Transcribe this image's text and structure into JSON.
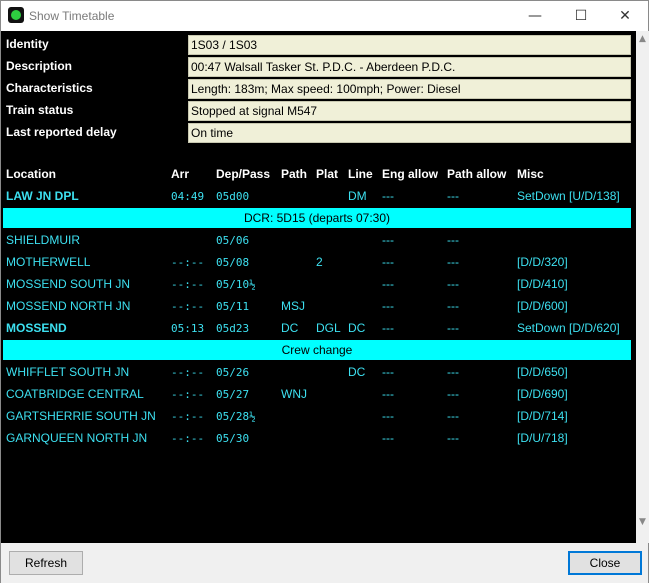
{
  "window": {
    "title": "Show Timetable",
    "min_symbol": "—",
    "max_symbol": "☐",
    "close_symbol": "✕"
  },
  "info": [
    {
      "label": "Identity",
      "value": "1S03 / 1S03"
    },
    {
      "label": "Description",
      "value": "00:47 Walsall Tasker St. P.D.C. - Aberdeen P.D.C."
    },
    {
      "label": "Characteristics",
      "value": "Length: 183m; Max speed: 100mph; Power: Diesel"
    },
    {
      "label": "Train status",
      "value": "Stopped at signal M547"
    },
    {
      "label": "Last reported delay",
      "value": "On time"
    }
  ],
  "columns": {
    "location": "Location",
    "arr": "Arr",
    "dep": "Dep/Pass",
    "path": "Path",
    "plat": "Plat",
    "line": "Line",
    "eng": "Eng allow",
    "pallow": "Path allow",
    "misc": "Misc"
  },
  "rows": [
    {
      "loc": "LAW JN DPL",
      "arr": "04:49",
      "dep": "05d00",
      "path": "",
      "plat": "",
      "line": "DM",
      "eng": "---",
      "pallow": "---",
      "misc": "SetDown [U/D/138]",
      "bold": true
    },
    {
      "banner": "DCR: 5D15 (departs 07:30)"
    },
    {
      "loc": "SHIELDMUIR",
      "arr": "",
      "dep": "05/06",
      "path": "",
      "plat": "",
      "line": "",
      "eng": "---",
      "pallow": "---",
      "misc": ""
    },
    {
      "loc": "MOTHERWELL",
      "arr": "--:--",
      "dep": "05/08",
      "path": "",
      "plat": "2",
      "line": "",
      "eng": "---",
      "pallow": "---",
      "misc": "[D/D/320]"
    },
    {
      "loc": "MOSSEND SOUTH JN",
      "arr": "--:--",
      "dep": "05/10½",
      "path": "",
      "plat": "",
      "line": "",
      "eng": "---",
      "pallow": "---",
      "misc": "[D/D/410]"
    },
    {
      "loc": "MOSSEND NORTH JN",
      "arr": "--:--",
      "dep": "05/11",
      "path": "MSJ",
      "plat": "",
      "line": "",
      "eng": "---",
      "pallow": "---",
      "misc": "[D/D/600]"
    },
    {
      "loc": "MOSSEND",
      "arr": "05:13",
      "dep": "05d23",
      "path": "DC",
      "plat": "DGL",
      "line": "DC",
      "eng": "---",
      "pallow": "---",
      "misc": "SetDown [D/D/620]",
      "bold": true
    },
    {
      "banner": "Crew change"
    },
    {
      "loc": "WHIFFLET SOUTH JN",
      "arr": "--:--",
      "dep": "05/26",
      "path": "",
      "plat": "",
      "line": "DC",
      "eng": "---",
      "pallow": "---",
      "misc": "[D/D/650]"
    },
    {
      "loc": "COATBRIDGE CENTRAL",
      "arr": "--:--",
      "dep": "05/27",
      "path": "WNJ",
      "plat": "",
      "line": "",
      "eng": "---",
      "pallow": "---",
      "misc": "[D/D/690]"
    },
    {
      "loc": "GARTSHERRIE SOUTH JN",
      "arr": "--:--",
      "dep": "05/28½",
      "path": "",
      "plat": "",
      "line": "",
      "eng": "---",
      "pallow": "---",
      "misc": "[D/D/714]"
    },
    {
      "loc": "GARNQUEEN NORTH JN",
      "arr": "--:--",
      "dep": "05/30",
      "path": "",
      "plat": "",
      "line": "",
      "eng": "---",
      "pallow": "---",
      "misc": "[D/U/718]"
    }
  ],
  "buttons": {
    "refresh": "Refresh",
    "close": "Close"
  },
  "icons": {
    "app": "timetable-app-icon",
    "scroll_up": "▲",
    "scroll_down": "▼"
  },
  "colors": {
    "cyan": "#3de0f0",
    "banner": "#00ffff",
    "background": "#000000"
  }
}
